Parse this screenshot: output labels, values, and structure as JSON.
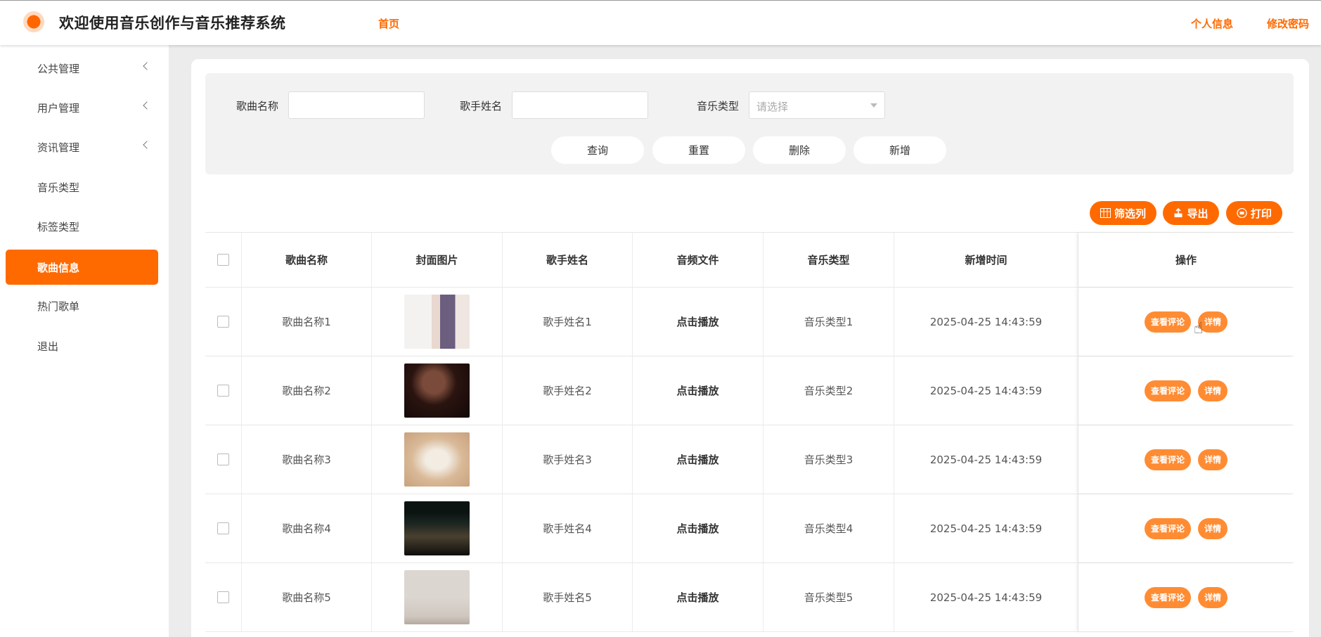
{
  "header": {
    "title": "欢迎使用音乐创作与音乐推荐系统",
    "home": "首页",
    "profile": "个人信息",
    "change_password": "修改密码"
  },
  "sidebar": {
    "items": [
      {
        "label": "公共管理",
        "expandable": true
      },
      {
        "label": "用户管理",
        "expandable": true
      },
      {
        "label": "资讯管理",
        "expandable": true
      },
      {
        "label": "音乐类型",
        "expandable": false
      },
      {
        "label": "标签类型",
        "expandable": false
      },
      {
        "label": "歌曲信息",
        "expandable": false,
        "active": true
      },
      {
        "label": "热门歌单",
        "expandable": false
      },
      {
        "label": "退出",
        "expandable": false
      }
    ]
  },
  "search": {
    "song_name_label": "歌曲名称",
    "song_name_value": "",
    "singer_label": "歌手姓名",
    "singer_value": "",
    "type_label": "音乐类型",
    "type_placeholder": "请选择",
    "buttons": {
      "query": "查询",
      "reset": "重置",
      "delete": "删除",
      "add": "新增"
    }
  },
  "toolbar": {
    "filter_columns": "筛选列",
    "export": "导出",
    "print": "打印"
  },
  "table": {
    "headers": [
      "歌曲名称",
      "封面图片",
      "歌手姓名",
      "音频文件",
      "音乐类型",
      "新增时间",
      "操作"
    ],
    "rows": [
      {
        "name": "歌曲名称1",
        "singer": "歌手姓名1",
        "audio": "点击播放",
        "type": "音乐类型1",
        "time": "2025-04-25 14:43:59"
      },
      {
        "name": "歌曲名称2",
        "singer": "歌手姓名2",
        "audio": "点击播放",
        "type": "音乐类型2",
        "time": "2025-04-25 14:43:59"
      },
      {
        "name": "歌曲名称3",
        "singer": "歌手姓名3",
        "audio": "点击播放",
        "type": "音乐类型3",
        "time": "2025-04-25 14:43:59"
      },
      {
        "name": "歌曲名称4",
        "singer": "歌手姓名4",
        "audio": "点击播放",
        "type": "音乐类型4",
        "time": "2025-04-25 14:43:59"
      },
      {
        "name": "歌曲名称5",
        "singer": "歌手姓名5",
        "audio": "点击播放",
        "type": "音乐类型5",
        "time": "2025-04-25 14:43:59"
      }
    ],
    "action_comments": "查看评论",
    "action_detail": "详情"
  },
  "colors": {
    "accent": "#ff6a00",
    "accent_light": "#ff8c33"
  },
  "icons": {
    "logo": "circle-logo",
    "filter": "columns-icon",
    "export": "export-icon",
    "print": "printer-icon",
    "chevron": "chevron-left-icon",
    "cursor": "hand-pointer-icon"
  }
}
